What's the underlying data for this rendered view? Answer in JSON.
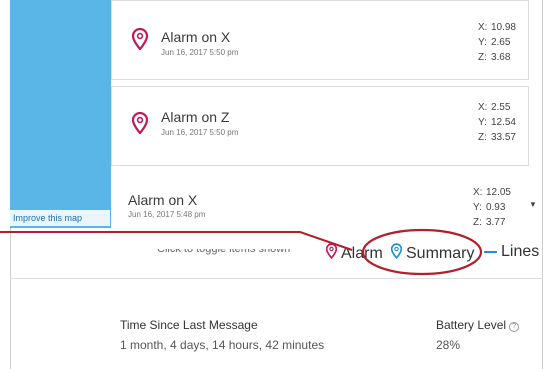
{
  "map": {
    "improve_link": "Improve this map"
  },
  "alarms": [
    {
      "title": "Alarm on X",
      "date": "Jun 16, 2017 5:50 pm",
      "x": "10.98",
      "y": "2.65",
      "z": "3.68"
    },
    {
      "title": "Alarm on Z",
      "date": "Jun 16, 2017 5:50 pm",
      "x": "2.55",
      "y": "12.54",
      "z": "33.57"
    },
    {
      "title": "Alarm on X",
      "date": "Jun 16, 2017 5:48 pm",
      "x": "12.05",
      "y": "0.93",
      "z": "3.77"
    }
  ],
  "coord_labels": {
    "x": "X:",
    "y": "Y:",
    "z": "Z:"
  },
  "legend": {
    "hint": "Click to toggle items shown",
    "alarm_label": "Alarm",
    "summary_label": "Summary",
    "lines_label": "Lines"
  },
  "stats": {
    "time_label": "Time Since Last Message",
    "time_value": "1 month, 4 days, 14 hours, 42 minutes",
    "battery_label": "Battery Level",
    "battery_value": "28%"
  },
  "colors": {
    "alarm_pin": "#c2185b",
    "summary_pin": "#1e90d6",
    "map_blue": "#5ab6e6",
    "callout_red": "#b3202a"
  }
}
